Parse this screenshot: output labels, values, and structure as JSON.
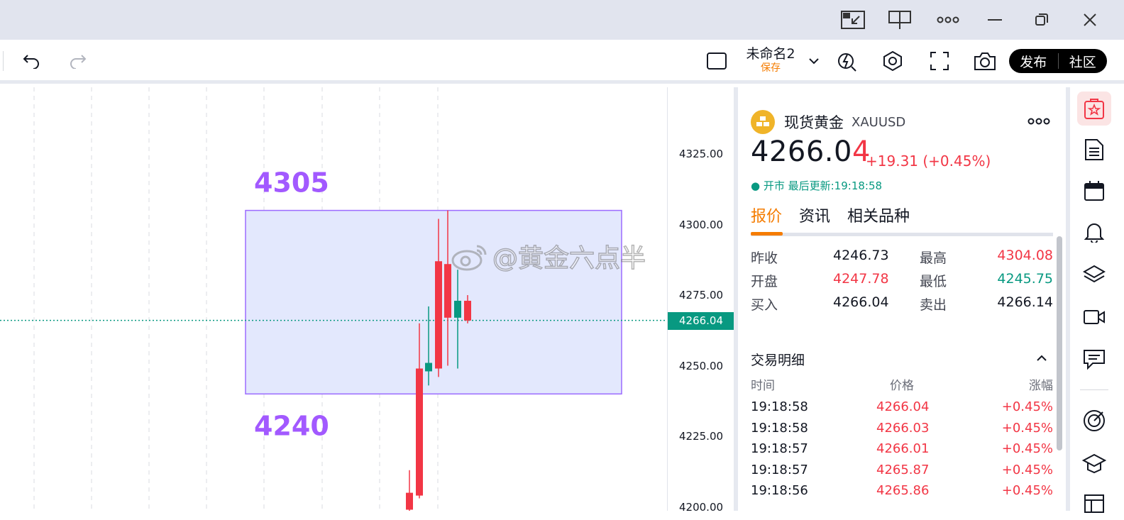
{
  "window": {
    "icons": [
      "pip-icon",
      "layout-split-icon",
      "more-icon",
      "minimize-icon",
      "restore-icon",
      "close-icon"
    ]
  },
  "toolbar": {
    "layout_name": "未命名2",
    "save_label": "保存",
    "publish_label": "发布",
    "community_label": "社区"
  },
  "chart": {
    "axis_ticks": [
      "4325.00",
      "4300.00",
      "4275.00",
      "4250.00",
      "4225.00",
      "4200.00"
    ],
    "current_price": "4266.04",
    "upper_label": "4305",
    "lower_label": "4240",
    "watermark": "@黄金六点半",
    "up_color": "#089981",
    "down_color": "#f23645",
    "box_border_color": "#9c6bff",
    "label_color": "#a259ff"
  },
  "chart_data": {
    "type": "candlestick",
    "y_range": [
      4200,
      4330
    ],
    "box": {
      "top": 4305,
      "bottom": 4240
    },
    "candles": [
      {
        "open": 4205,
        "close": 4199,
        "high": 4213,
        "low": 4195
      },
      {
        "open": 4249,
        "close": 4204,
        "high": 4265,
        "low": 4203
      },
      {
        "open": 4248,
        "close": 4251,
        "high": 4271,
        "low": 4243
      },
      {
        "open": 4287,
        "close": 4249,
        "high": 4302,
        "low": 4246
      },
      {
        "open": 4286,
        "close": 4267,
        "high": 4305,
        "low": 4250
      },
      {
        "open": 4267,
        "close": 4273,
        "high": 4284,
        "low": 4249
      },
      {
        "open": 4273,
        "close": 4266,
        "high": 4275,
        "low": 4265
      }
    ]
  },
  "panel": {
    "symbol_name": "现货黄金",
    "symbol_code": "XAUUSD",
    "price_main": "4266.0",
    "price_last_digit": "4",
    "change": "+19.31 (+0.45%)",
    "market_status": "● 开市 最后更新:19:18:58",
    "tabs": [
      "报价",
      "资讯",
      "相关品种"
    ],
    "quotes": [
      {
        "l1": "昨收",
        "v1": "4246.73",
        "l2": "最高",
        "v2": "4304.08"
      },
      {
        "l1": "开盘",
        "v1": "4247.78",
        "l2": "最低",
        "v2": "4245.75"
      },
      {
        "l1": "买入",
        "v1": "4266.04",
        "l2": "卖出",
        "v2": "4266.14"
      }
    ],
    "section_title": "交易明细",
    "trade_headers": [
      "时间",
      "价格",
      "涨幅"
    ],
    "trades": [
      {
        "time": "19:18:58",
        "price": "4266.04",
        "chg": "+0.45%"
      },
      {
        "time": "19:18:58",
        "price": "4266.03",
        "chg": "+0.45%"
      },
      {
        "time": "19:18:57",
        "price": "4266.01",
        "chg": "+0.45%"
      },
      {
        "time": "19:18:57",
        "price": "4265.87",
        "chg": "+0.45%"
      },
      {
        "time": "19:18:56",
        "price": "4265.86",
        "chg": "+0.45%"
      }
    ]
  }
}
